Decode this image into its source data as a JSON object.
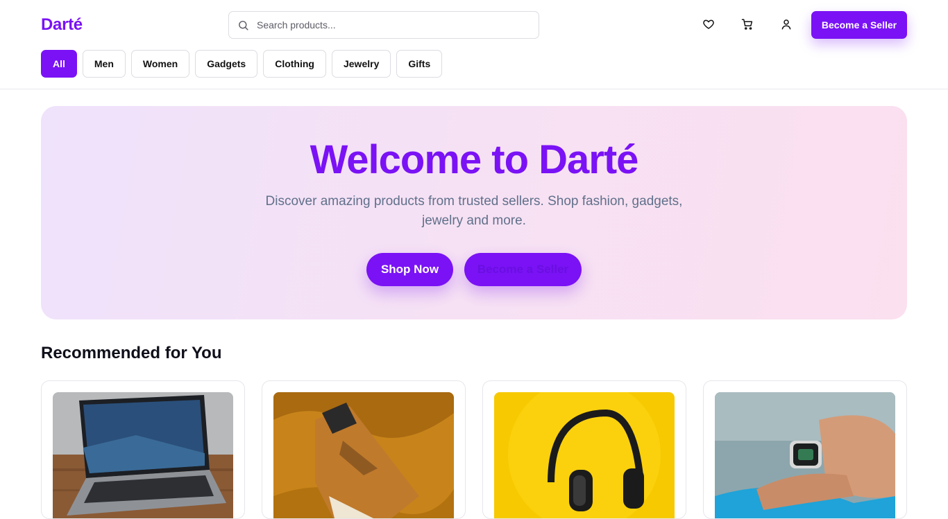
{
  "header": {
    "logo": "Darté",
    "search": {
      "placeholder": "Search products...",
      "value": ""
    },
    "icons": [
      "heart-icon",
      "cart-icon",
      "user-icon"
    ],
    "seller_button": "Become a Seller"
  },
  "categories": [
    {
      "label": "All",
      "active": true
    },
    {
      "label": "Men",
      "active": false
    },
    {
      "label": "Women",
      "active": false
    },
    {
      "label": "Gadgets",
      "active": false
    },
    {
      "label": "Clothing",
      "active": false
    },
    {
      "label": "Jewelry",
      "active": false
    },
    {
      "label": "Gifts",
      "active": false
    }
  ],
  "hero": {
    "title": "Welcome to Darté",
    "subtitle": "Discover amazing products from trusted sellers. Shop fashion, gadgets, jewelry and more.",
    "primary_button": "Shop Now",
    "secondary_button": "Become a Seller"
  },
  "recommended": {
    "title": "Recommended for You",
    "products": [
      {
        "image": "laptop-image"
      },
      {
        "image": "sneaker-image"
      },
      {
        "image": "headphones-image"
      },
      {
        "image": "smartwatch-image"
      }
    ]
  },
  "colors": {
    "accent": "#7a12f5",
    "hero_gradient_start": "#efe2fb",
    "hero_gradient_end": "#fbe0ef",
    "subtitle": "#60708a"
  }
}
